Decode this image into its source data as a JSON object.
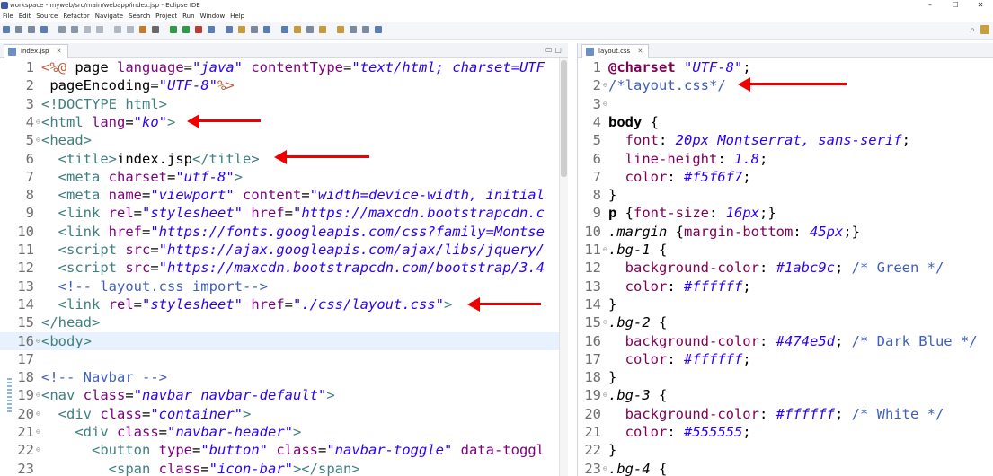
{
  "window": {
    "title": "workspace - myweb/src/main/webapp/index.jsp - Eclipse IDE"
  },
  "menu": [
    "File",
    "Edit",
    "Source",
    "Refactor",
    "Navigate",
    "Search",
    "Project",
    "Run",
    "Window",
    "Help"
  ],
  "left_tab": {
    "label": "index.jsp",
    "close": "✕"
  },
  "right_tab": {
    "label": "layout.css",
    "close": "✕"
  },
  "left_lines": [
    {
      "n": "1",
      "fold": "",
      "segs": [
        [
          "jsp",
          "<%@"
        ],
        [
          "",
          " page "
        ],
        [
          "attr",
          "language"
        ],
        [
          "",
          "="
        ],
        [
          "str",
          "\"java\""
        ],
        [
          "",
          " "
        ],
        [
          "attr",
          "contentType"
        ],
        [
          "",
          "="
        ],
        [
          "str",
          "\"text/html; charset=UTF"
        ]
      ]
    },
    {
      "n": "2",
      "fold": "",
      "segs": [
        [
          "",
          " pageEncoding="
        ],
        [
          "str",
          "\"UTF-8\""
        ],
        [
          "jsp",
          "%>"
        ]
      ]
    },
    {
      "n": "3",
      "fold": "",
      "segs": [
        [
          "tag",
          "<!DOCTYPE html>"
        ]
      ]
    },
    {
      "n": "4",
      "fold": "⊖",
      "segs": [
        [
          "tag",
          "<html "
        ],
        [
          "attr",
          "lang"
        ],
        [
          "",
          "="
        ],
        [
          "str",
          "\"ko\""
        ],
        [
          "tag",
          ">"
        ]
      ]
    },
    {
      "n": "5",
      "fold": "⊖",
      "segs": [
        [
          "tag",
          "<head>"
        ]
      ]
    },
    {
      "n": "6",
      "fold": "",
      "segs": [
        [
          "tag",
          "  <title>"
        ],
        [
          "",
          "index.jsp"
        ],
        [
          "tag",
          "</title>"
        ]
      ]
    },
    {
      "n": "7",
      "fold": "",
      "segs": [
        [
          "tag",
          "  <meta "
        ],
        [
          "attr",
          "charset"
        ],
        [
          "",
          "="
        ],
        [
          "str",
          "\"utf-8\""
        ],
        [
          "tag",
          ">"
        ]
      ]
    },
    {
      "n": "8",
      "fold": "",
      "segs": [
        [
          "tag",
          "  <meta "
        ],
        [
          "attr",
          "name"
        ],
        [
          "",
          "="
        ],
        [
          "str",
          "\"viewport\""
        ],
        [
          "",
          " "
        ],
        [
          "attr",
          "content"
        ],
        [
          "",
          "="
        ],
        [
          "str",
          "\"width=device-width, initial"
        ]
      ]
    },
    {
      "n": "9",
      "fold": "",
      "segs": [
        [
          "tag",
          "  <link "
        ],
        [
          "attr",
          "rel"
        ],
        [
          "",
          "="
        ],
        [
          "str",
          "\"stylesheet\""
        ],
        [
          "",
          " "
        ],
        [
          "attr",
          "href"
        ],
        [
          "",
          "="
        ],
        [
          "str",
          "\"https://maxcdn.bootstrapcdn.c"
        ]
      ]
    },
    {
      "n": "10",
      "fold": "",
      "segs": [
        [
          "tag",
          "  <link "
        ],
        [
          "attr",
          "href"
        ],
        [
          "",
          "="
        ],
        [
          "str",
          "\"https://fonts.googleapis.com/css?family=Montse"
        ]
      ]
    },
    {
      "n": "11",
      "fold": "",
      "segs": [
        [
          "tag",
          "  <script "
        ],
        [
          "attr",
          "src"
        ],
        [
          "",
          "="
        ],
        [
          "str",
          "\"https://ajax.googleapis.com/ajax/libs/jquery/"
        ]
      ]
    },
    {
      "n": "12",
      "fold": "",
      "segs": [
        [
          "tag",
          "  <script "
        ],
        [
          "attr",
          "src"
        ],
        [
          "",
          "="
        ],
        [
          "str",
          "\"https://maxcdn.bootstrapcdn.com/bootstrap/3.4"
        ]
      ]
    },
    {
      "n": "13",
      "fold": "",
      "segs": [
        [
          "cmt",
          "  <!-- layout.css import-->"
        ]
      ]
    },
    {
      "n": "14",
      "fold": "",
      "segs": [
        [
          "tag",
          "  <link "
        ],
        [
          "attr",
          "rel"
        ],
        [
          "",
          "="
        ],
        [
          "str",
          "\"stylesheet\""
        ],
        [
          "",
          " "
        ],
        [
          "attr",
          "href"
        ],
        [
          "",
          "="
        ],
        [
          "str",
          "\"./css/layout.css\""
        ],
        [
          "tag",
          ">"
        ]
      ]
    },
    {
      "n": "15",
      "fold": "",
      "segs": [
        [
          "tag",
          "</head>"
        ]
      ]
    },
    {
      "n": "16",
      "fold": "⊖",
      "segs": [
        [
          "tag",
          "<body>"
        ]
      ],
      "current": true
    },
    {
      "n": "17",
      "fold": "",
      "segs": []
    },
    {
      "n": "18",
      "fold": "",
      "segs": [
        [
          "cmt",
          "<!-- Navbar -->"
        ]
      ]
    },
    {
      "n": "19",
      "fold": "⊖",
      "segs": [
        [
          "tag",
          "<nav "
        ],
        [
          "attr",
          "class"
        ],
        [
          "",
          "="
        ],
        [
          "str",
          "\"navbar navbar-default\""
        ],
        [
          "tag",
          ">"
        ]
      ]
    },
    {
      "n": "20",
      "fold": "⊖",
      "segs": [
        [
          "tag",
          "  <div "
        ],
        [
          "attr",
          "class"
        ],
        [
          "",
          "="
        ],
        [
          "str",
          "\"container\""
        ],
        [
          "tag",
          ">"
        ]
      ]
    },
    {
      "n": "21",
      "fold": "⊖",
      "segs": [
        [
          "tag",
          "    <div "
        ],
        [
          "attr",
          "class"
        ],
        [
          "",
          "="
        ],
        [
          "str",
          "\"navbar-header\""
        ],
        [
          "tag",
          ">"
        ]
      ]
    },
    {
      "n": "22",
      "fold": "⊖",
      "segs": [
        [
          "tag",
          "      <button "
        ],
        [
          "attr",
          "type"
        ],
        [
          "",
          "="
        ],
        [
          "str",
          "\"button\""
        ],
        [
          "",
          " "
        ],
        [
          "attr",
          "class"
        ],
        [
          "",
          "="
        ],
        [
          "str",
          "\"navbar-toggle\""
        ],
        [
          "",
          " "
        ],
        [
          "attr",
          "data-toggl"
        ]
      ]
    },
    {
      "n": "23",
      "fold": "",
      "segs": [
        [
          "tag",
          "        <span "
        ],
        [
          "attr",
          "class"
        ],
        [
          "",
          "="
        ],
        [
          "str",
          "\"icon-bar\""
        ],
        [
          "tag",
          "></span>"
        ]
      ]
    }
  ],
  "right_lines": [
    {
      "n": "1",
      "fold": "",
      "segs": [
        [
          "kw",
          "@charset"
        ],
        [
          "",
          " "
        ],
        [
          "val",
          "\"UTF-8\""
        ],
        [
          "",
          ";"
        ]
      ]
    },
    {
      "n": "2",
      "fold": "⊖",
      "segs": [
        [
          "cmt",
          "/*layout.css*/"
        ]
      ]
    },
    {
      "n": "3",
      "fold": "⊖",
      "segs": []
    },
    {
      "n": "4",
      "fold": "",
      "segs": [
        [
          "sel",
          "body"
        ],
        [
          "",
          " {"
        ]
      ]
    },
    {
      "n": "5",
      "fold": "",
      "segs": [
        [
          "prop",
          "  font"
        ],
        [
          "",
          ": "
        ],
        [
          "val",
          "20px Montserrat, sans-serif"
        ],
        [
          "",
          ";"
        ]
      ]
    },
    {
      "n": "6",
      "fold": "",
      "segs": [
        [
          "prop",
          "  line-height"
        ],
        [
          "",
          ": "
        ],
        [
          "val",
          "1.8"
        ],
        [
          "",
          ";"
        ]
      ]
    },
    {
      "n": "7",
      "fold": "",
      "segs": [
        [
          "prop",
          "  color"
        ],
        [
          "",
          ": "
        ],
        [
          "val",
          "#f5f6f7"
        ],
        [
          "",
          ";"
        ]
      ]
    },
    {
      "n": "8",
      "fold": "",
      "segs": [
        [
          "",
          "}"
        ]
      ]
    },
    {
      "n": "9",
      "fold": "",
      "segs": [
        [
          "sel",
          "p"
        ],
        [
          "",
          " {"
        ],
        [
          "prop",
          "font-size"
        ],
        [
          "",
          ": "
        ],
        [
          "val",
          "16px"
        ],
        [
          "",
          ";}"
        ]
      ]
    },
    {
      "n": "10",
      "fold": "",
      "segs": [
        [
          "pseudo",
          ".margin"
        ],
        [
          "",
          " {"
        ],
        [
          "prop",
          "margin-bottom"
        ],
        [
          "",
          ": "
        ],
        [
          "val",
          "45px"
        ],
        [
          "",
          ";}"
        ]
      ]
    },
    {
      "n": "11",
      "fold": "⊖",
      "segs": [
        [
          "pseudo",
          ".bg-1"
        ],
        [
          "",
          " {"
        ]
      ]
    },
    {
      "n": "12",
      "fold": "",
      "segs": [
        [
          "prop",
          "  background-color"
        ],
        [
          "",
          ": "
        ],
        [
          "val",
          "#1abc9c"
        ],
        [
          "",
          "; "
        ],
        [
          "cmt",
          "/* Green */"
        ]
      ]
    },
    {
      "n": "13",
      "fold": "",
      "segs": [
        [
          "prop",
          "  color"
        ],
        [
          "",
          ": "
        ],
        [
          "val",
          "#ffffff"
        ],
        [
          "",
          ";"
        ]
      ]
    },
    {
      "n": "14",
      "fold": "",
      "segs": [
        [
          "",
          "}"
        ]
      ]
    },
    {
      "n": "15",
      "fold": "⊖",
      "segs": [
        [
          "pseudo",
          ".bg-2"
        ],
        [
          "",
          " {"
        ]
      ]
    },
    {
      "n": "16",
      "fold": "",
      "segs": [
        [
          "prop",
          "  background-color"
        ],
        [
          "",
          ": "
        ],
        [
          "val",
          "#474e5d"
        ],
        [
          "",
          "; "
        ],
        [
          "cmt",
          "/* Dark Blue */"
        ]
      ]
    },
    {
      "n": "17",
      "fold": "",
      "segs": [
        [
          "prop",
          "  color"
        ],
        [
          "",
          ": "
        ],
        [
          "val",
          "#ffffff"
        ],
        [
          "",
          ";"
        ]
      ]
    },
    {
      "n": "18",
      "fold": "",
      "segs": [
        [
          "",
          "}"
        ]
      ]
    },
    {
      "n": "19",
      "fold": "⊖",
      "segs": [
        [
          "pseudo",
          ".bg-3"
        ],
        [
          "",
          " {"
        ]
      ]
    },
    {
      "n": "20",
      "fold": "",
      "segs": [
        [
          "prop",
          "  background-color"
        ],
        [
          "",
          ": "
        ],
        [
          "val",
          "#ffffff"
        ],
        [
          "",
          "; "
        ],
        [
          "cmt",
          "/* White */"
        ]
      ]
    },
    {
      "n": "21",
      "fold": "",
      "segs": [
        [
          "prop",
          "  color"
        ],
        [
          "",
          ": "
        ],
        [
          "val",
          "#555555"
        ],
        [
          "",
          ";"
        ]
      ]
    },
    {
      "n": "22",
      "fold": "",
      "segs": [
        [
          "",
          "}"
        ]
      ]
    },
    {
      "n": "23",
      "fold": "⊖",
      "segs": [
        [
          "pseudo",
          ".bg-4"
        ],
        [
          "",
          " {"
        ]
      ]
    }
  ],
  "toolbar_icons": [
    {
      "color": "#5a7db5"
    },
    {
      "color": "#7a8aa0"
    },
    {
      "color": "#7a8aa0"
    },
    {
      "color": "#5a7db5"
    },
    {
      "color": "#8a96aa"
    },
    {
      "color": "#8a96aa"
    },
    {
      "color": "#b0b8c4"
    },
    {
      "color": "#b0b8c4"
    },
    {
      "color": "#b0b8c4"
    },
    {
      "color": "#b0b8c4"
    },
    {
      "color": "#c27a2f"
    },
    {
      "color": "#6a6a6a"
    },
    {
      "color": "#2e9b46"
    },
    {
      "color": "#2e9b46"
    },
    {
      "color": "#c23a2f"
    },
    {
      "color": "#5a7db5"
    },
    {
      "color": "#5a7db5"
    },
    {
      "color": "#c89a3a"
    },
    {
      "color": "#7a8aa0"
    },
    {
      "color": "#5a7db5"
    },
    {
      "color": "#5a7db5"
    },
    {
      "color": "#c89a3a"
    },
    {
      "color": "#7a8aa0"
    },
    {
      "color": "#c89a3a"
    },
    {
      "color": "#c89a3a"
    },
    {
      "color": "#7a8aa0"
    },
    {
      "color": "#7a8aa0"
    },
    {
      "color": "#5a7db5"
    }
  ]
}
